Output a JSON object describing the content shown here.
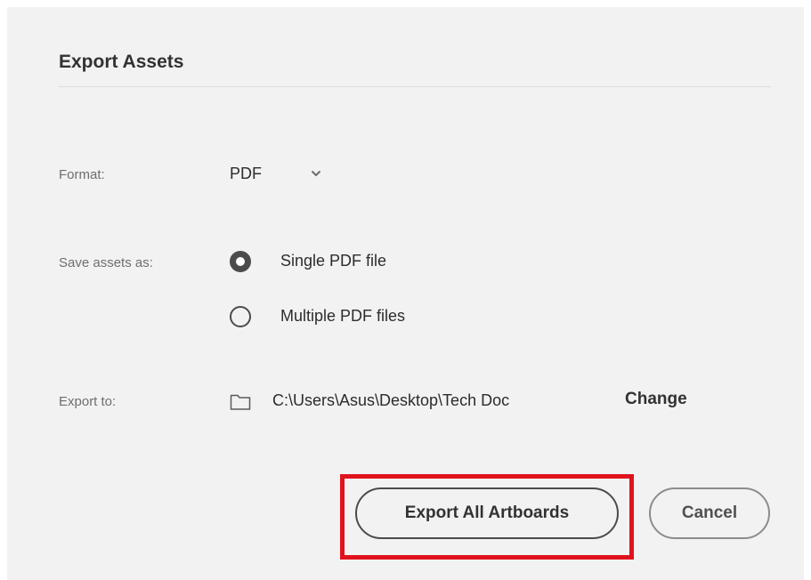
{
  "dialog": {
    "title": "Export Assets"
  },
  "format": {
    "label": "Format:",
    "selected": "PDF",
    "dropdown_icon": "chevron-down-icon"
  },
  "save_as": {
    "label": "Save assets as:",
    "options": [
      {
        "label": "Single PDF file",
        "selected": true
      },
      {
        "label": "Multiple PDF files",
        "selected": false
      }
    ]
  },
  "export_to": {
    "label": "Export to:",
    "folder_icon": "folder-icon",
    "path": "C:\\Users\\Asus\\Desktop\\Tech Doc",
    "change_label": "Change"
  },
  "actions": {
    "primary_label": "Export All Artboards",
    "cancel_label": "Cancel"
  },
  "colors": {
    "background": "#f2f2f2",
    "text": "#323232",
    "muted": "#6e6e6e",
    "highlight": "#e0131d"
  }
}
